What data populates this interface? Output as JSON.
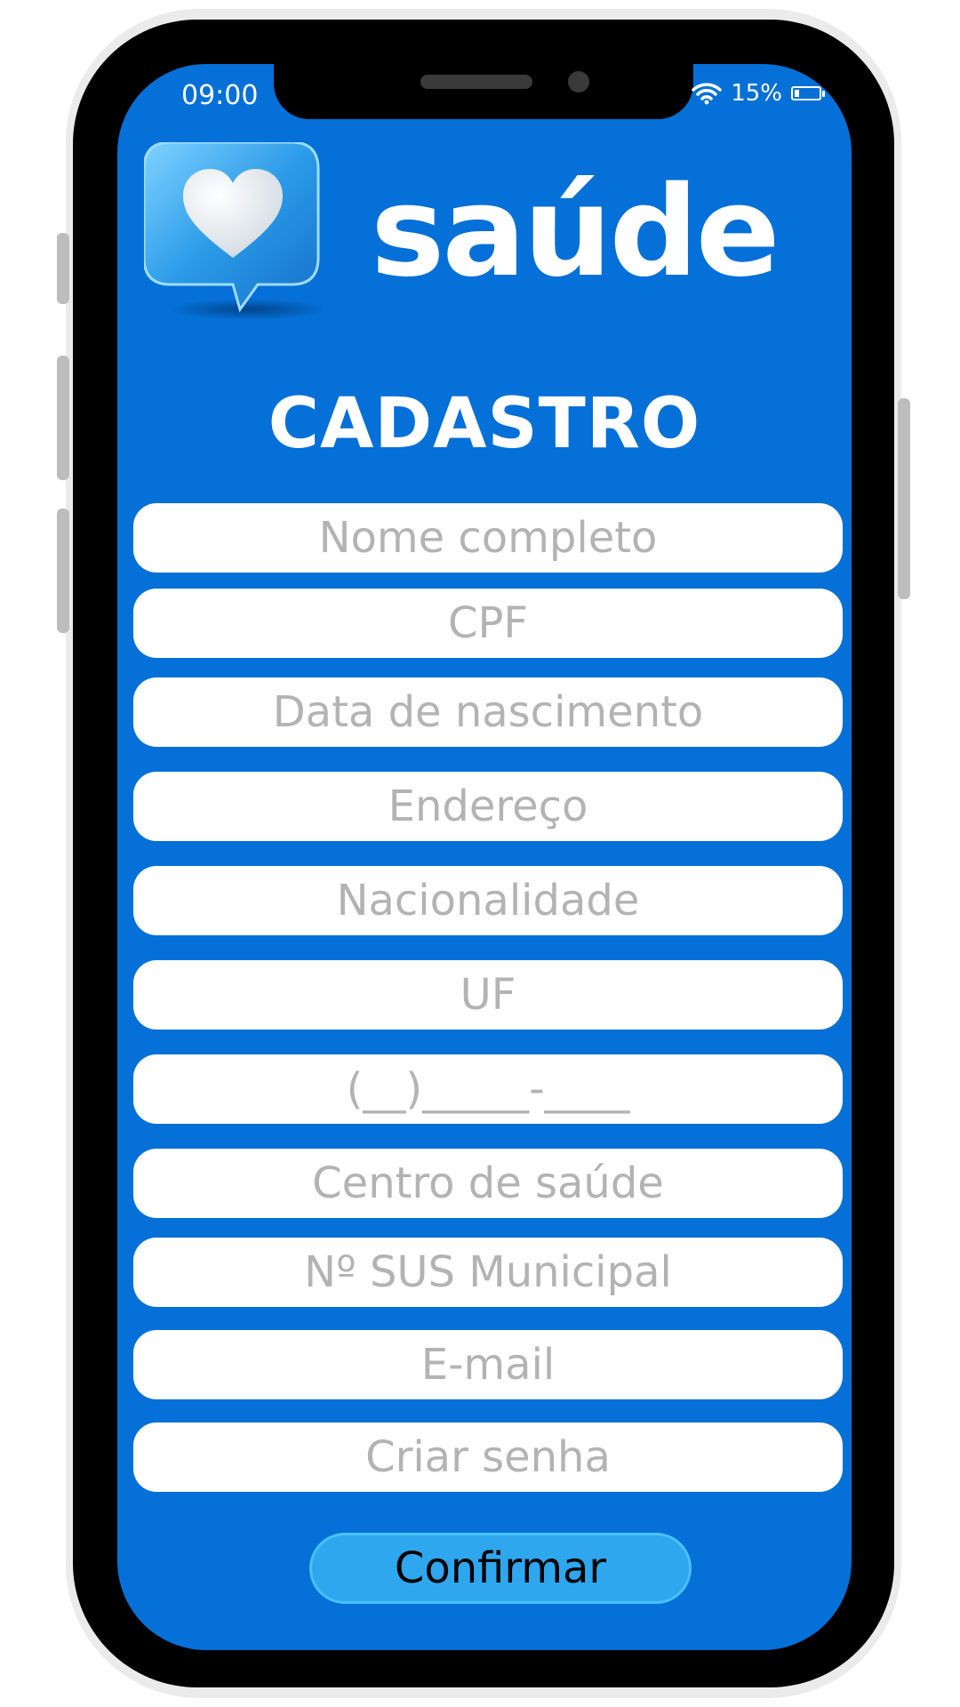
{
  "status_bar": {
    "time": "09:00",
    "battery": "15%"
  },
  "header": {
    "app_name": "saúde",
    "page_title": "CADASTRO"
  },
  "form": {
    "fields": [
      {
        "placeholder": "Nome completo"
      },
      {
        "placeholder": "CPF"
      },
      {
        "placeholder": "Data de nascimento"
      },
      {
        "placeholder": "Endereço"
      },
      {
        "placeholder": "Nacionalidade"
      },
      {
        "placeholder": "UF"
      },
      {
        "placeholder": "(__)_____-____"
      },
      {
        "placeholder": "Centro de saúde"
      },
      {
        "placeholder": "Nº SUS Municipal"
      },
      {
        "placeholder": "E-mail"
      },
      {
        "placeholder": "Criar senha"
      }
    ],
    "confirm_label": "Confirmar"
  },
  "colors": {
    "screen_background": "#0570d7",
    "button_background": "#2ea7ef",
    "field_background": "#ffffff",
    "placeholder_text": "#b3b3b3"
  },
  "icons": [
    "heart-speech-bubble-icon",
    "wifi-icon",
    "battery-icon"
  ]
}
